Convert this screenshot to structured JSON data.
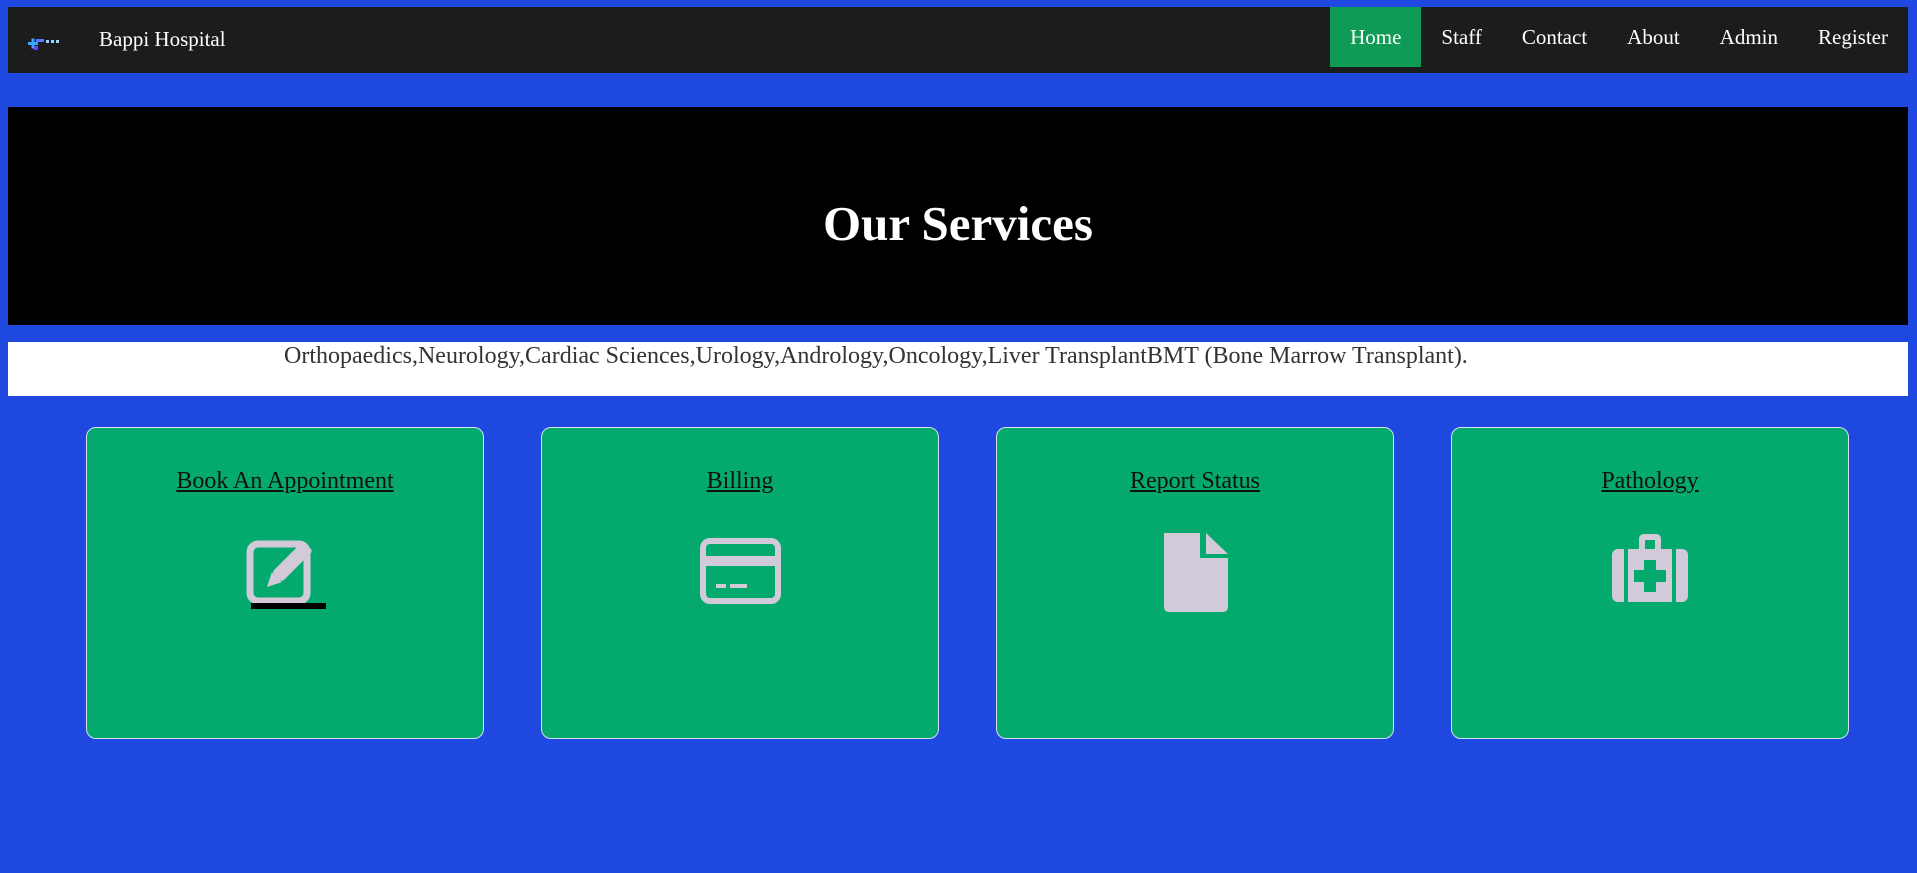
{
  "app": {
    "brand_name": "Bappi Hospital"
  },
  "nav": {
    "items": [
      {
        "label": "Home",
        "active": true
      },
      {
        "label": "Staff",
        "active": false
      },
      {
        "label": "Contact",
        "active": false
      },
      {
        "label": "About",
        "active": false
      },
      {
        "label": "Admin",
        "active": false
      },
      {
        "label": "Register",
        "active": false
      }
    ]
  },
  "hero": {
    "title": "Our Services"
  },
  "services": {
    "text": "Orthopaedics,Neurology,Cardiac Sciences,Urology,Andrology,Oncology,Liver TransplantBMT (Bone Marrow Transplant)."
  },
  "cards": [
    {
      "title": "Book An Appointment",
      "icon": "edit-icon"
    },
    {
      "title": "Billing",
      "icon": "credit-card-icon"
    },
    {
      "title": "Report Status",
      "icon": "file-icon"
    },
    {
      "title": "Pathology",
      "icon": "medical-kit-icon"
    }
  ],
  "colors": {
    "page_background": "#1f48e0",
    "navbar_background": "#1b1c1c",
    "active_nav": "#0f9b55",
    "card_background": "#04a96d",
    "icon_color": "#d2cad9"
  }
}
